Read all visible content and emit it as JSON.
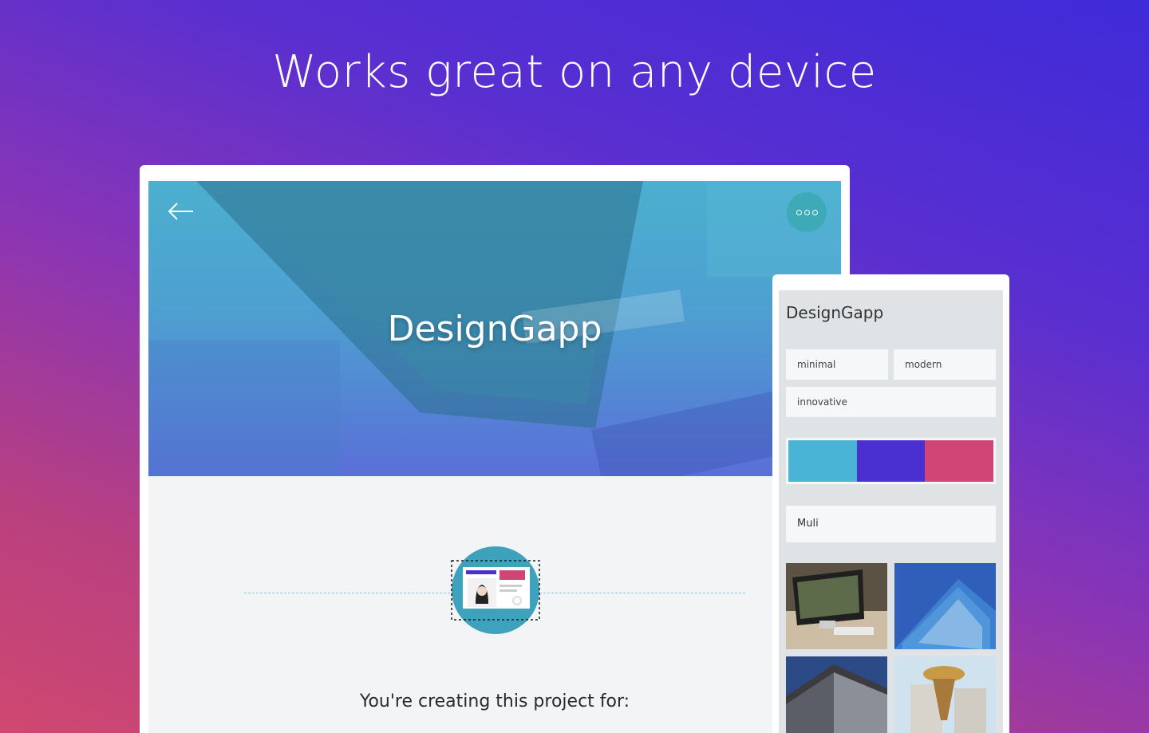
{
  "headline": "Works great on any device",
  "tablet": {
    "hero_title": "DesignGapp",
    "back_icon": "arrow-left-icon",
    "more_icon": "more-dots-icon",
    "creating_text": "You're creating this project for:"
  },
  "phone": {
    "title": "DesignGapp",
    "tags": [
      "minimal",
      "modern",
      "innovative"
    ],
    "palette": [
      "#4ab4d6",
      "#4a2fd1",
      "#d04576"
    ],
    "font": "Muli",
    "images": [
      "desk-monitor-image",
      "glass-building-image",
      "modern-building-image",
      "tower-image"
    ],
    "progress_fraction": 0.9
  },
  "colors": {
    "accent": "#3fa2bd",
    "bg_top": "#3f2bd8",
    "bg_bottom": "#cf4870"
  }
}
